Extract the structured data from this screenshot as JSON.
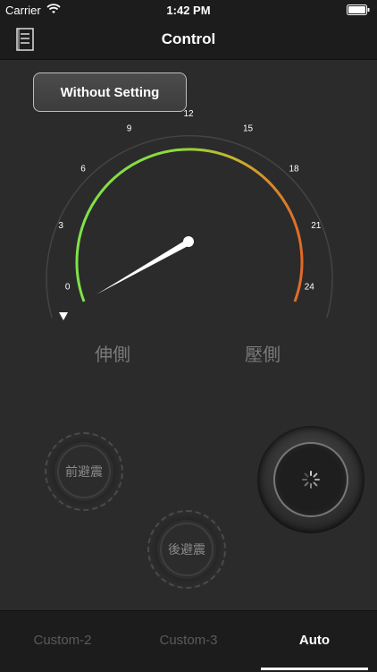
{
  "status": {
    "carrier": "Carrier",
    "time": "1:42 PM"
  },
  "nav": {
    "title": "Control"
  },
  "preset_button": "Without Setting",
  "gauge": {
    "ticks": [
      "0",
      "3",
      "6",
      "9",
      "12",
      "15",
      "18",
      "21",
      "24"
    ],
    "value": 0,
    "colors": {
      "low": "#7ee24a",
      "mid": "#c8b230",
      "high": "#e06a28"
    }
  },
  "labels": {
    "left": "伸側",
    "right": "壓側"
  },
  "buttons": {
    "front": "前避震",
    "rear": "後避震"
  },
  "tabs": [
    {
      "label": "Custom-2",
      "active": false
    },
    {
      "label": "Custom-3",
      "active": false
    },
    {
      "label": "Auto",
      "active": true
    }
  ]
}
